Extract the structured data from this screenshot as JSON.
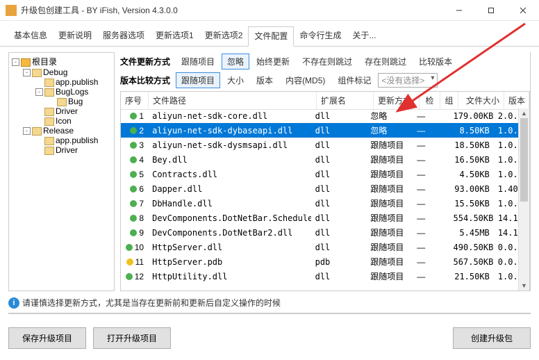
{
  "window": {
    "title": "升级包创建工具 - BY iFish, Version 4.3.0.0"
  },
  "mainTabs": [
    "基本信息",
    "更新说明",
    "服务器选项",
    "更新选项1",
    "更新选项2",
    "文件配置",
    "命令行生成",
    "关于..."
  ],
  "mainTabActive": 5,
  "tree": {
    "root": "根目录",
    "nodes": [
      {
        "label": "Debug",
        "children": [
          {
            "label": "app.publish"
          },
          {
            "label": "BugLogs",
            "children": [
              {
                "label": "Bug"
              }
            ]
          },
          {
            "label": "Driver"
          },
          {
            "label": "Icon"
          }
        ]
      },
      {
        "label": "Release",
        "children": [
          {
            "label": "app.publish"
          },
          {
            "label": "Driver"
          }
        ]
      }
    ]
  },
  "toolbar1": {
    "label": "文件更新方式",
    "items": [
      "跟随项目",
      "忽略",
      "始终更新",
      "不存在则跳过",
      "存在则跳过",
      "比较版本"
    ],
    "active": 1
  },
  "toolbar2": {
    "label": "版本比较方式",
    "items": [
      "跟随项目",
      "大小",
      "版本",
      "内容(MD5)",
      "组件标记"
    ],
    "active": 0,
    "comboPlaceholder": "<没有选择>"
  },
  "grid": {
    "headers": [
      "序号",
      "文件路径",
      "扩展名",
      "更新方式",
      "检",
      "组",
      "文件大小",
      "版本"
    ],
    "rows": [
      {
        "n": 1,
        "dot": "green",
        "path": "aliyun-net-sdk-core.dll",
        "ext": "dll",
        "upd": "忽略",
        "chk": "—",
        "grp": "",
        "size": "179.00KB",
        "ver": "2.0.",
        "sel": false
      },
      {
        "n": 2,
        "dot": "green",
        "path": "aliyun-net-sdk-dybaseapi.dll",
        "ext": "dll",
        "upd": "忽略",
        "chk": "—",
        "grp": "",
        "size": "8.50KB",
        "ver": "1.0.",
        "sel": true
      },
      {
        "n": 3,
        "dot": "green",
        "path": "aliyun-net-sdk-dysmsapi.dll",
        "ext": "dll",
        "upd": "跟随项目",
        "chk": "—",
        "grp": "",
        "size": "18.50KB",
        "ver": "1.0."
      },
      {
        "n": 4,
        "dot": "green",
        "path": "Bey.dll",
        "ext": "dll",
        "upd": "跟随项目",
        "chk": "—",
        "grp": "",
        "size": "16.50KB",
        "ver": "1.0."
      },
      {
        "n": 5,
        "dot": "green",
        "path": "Contracts.dll",
        "ext": "dll",
        "upd": "跟随项目",
        "chk": "—",
        "grp": "",
        "size": "4.50KB",
        "ver": "1.0."
      },
      {
        "n": 6,
        "dot": "green",
        "path": "Dapper.dll",
        "ext": "dll",
        "upd": "跟随项目",
        "chk": "—",
        "grp": "",
        "size": "93.00KB",
        "ver": "1.40"
      },
      {
        "n": 7,
        "dot": "green",
        "path": "DbHandle.dll",
        "ext": "dll",
        "upd": "跟随项目",
        "chk": "—",
        "grp": "",
        "size": "15.50KB",
        "ver": "1.0."
      },
      {
        "n": 8,
        "dot": "green",
        "path": "DevComponents.DotNetBar.Schedule.dll",
        "ext": "dll",
        "upd": "跟随项目",
        "chk": "—",
        "grp": "",
        "size": "554.50KB",
        "ver": "14.1"
      },
      {
        "n": 9,
        "dot": "green",
        "path": "DevComponents.DotNetBar2.dll",
        "ext": "dll",
        "upd": "跟随项目",
        "chk": "—",
        "grp": "",
        "size": "5.45MB",
        "ver": "14.1"
      },
      {
        "n": 10,
        "dot": "green",
        "path": "HttpServer.dll",
        "ext": "dll",
        "upd": "跟随项目",
        "chk": "—",
        "grp": "",
        "size": "490.50KB",
        "ver": "0.0."
      },
      {
        "n": 11,
        "dot": "yellow",
        "path": "HttpServer.pdb",
        "ext": "pdb",
        "upd": "跟随项目",
        "chk": "—",
        "grp": "",
        "size": "567.50KB",
        "ver": "0.0."
      },
      {
        "n": 12,
        "dot": "green",
        "path": "HttpUtility.dll",
        "ext": "dll",
        "upd": "跟随项目",
        "chk": "—",
        "grp": "",
        "size": "21.50KB",
        "ver": "1.0."
      }
    ]
  },
  "infoText": "请谨慎选择更新方式，尤其是当存在更新前和更新后自定义操作的时候",
  "buttons": {
    "save": "保存升级项目",
    "open": "打开升级项目",
    "create": "创建升级包"
  }
}
